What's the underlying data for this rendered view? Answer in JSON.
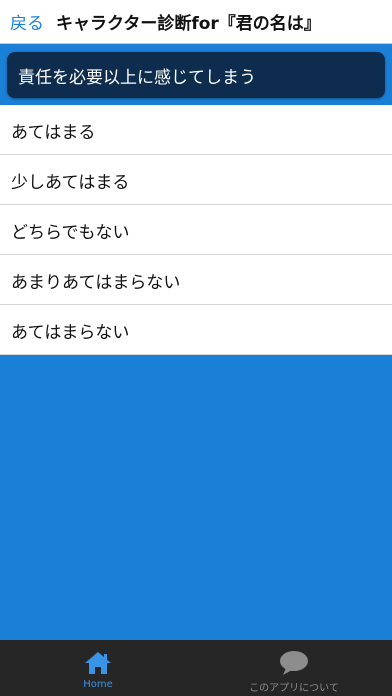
{
  "navbar": {
    "back_label": "戻る",
    "title": "キャラクター診断for『君の名は』"
  },
  "question": {
    "text": "責任を必要以上に感じてしまう"
  },
  "answers": [
    {
      "label": "あてはまる"
    },
    {
      "label": "少しあてはまる"
    },
    {
      "label": "どちらでもない"
    },
    {
      "label": "あまりあてはまらない"
    },
    {
      "label": "あてはまらない"
    }
  ],
  "tabbar": {
    "tabs": [
      {
        "label": "Home",
        "icon": "home-icon",
        "active": true
      },
      {
        "label": "このアプリについて",
        "icon": "speech-bubble-icon",
        "active": false
      }
    ]
  },
  "colors": {
    "background": "#1a7fd6",
    "question_bg": "#0e2d4e",
    "tabbar_bg": "#262626",
    "active_tab": "#3a94e6",
    "inactive_tab": "#8d8d8d"
  }
}
